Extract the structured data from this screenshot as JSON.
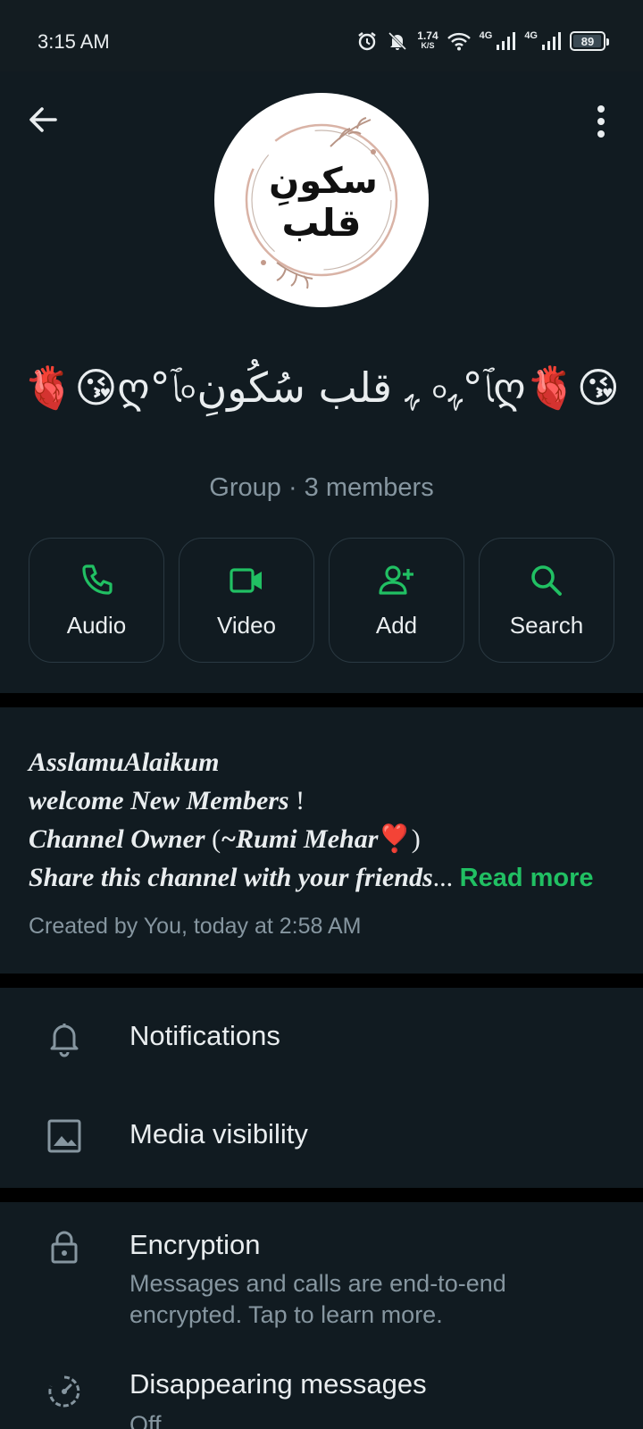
{
  "status_bar": {
    "time": "3:15 AM",
    "net_speed": "1.74",
    "net_unit": "K/S",
    "signal_1": "4G",
    "signal_2": "4G",
    "battery": "89",
    "icons": [
      "alarm-icon",
      "bell-muted-icon",
      "wifi-icon",
      "signal-icon",
      "signal-icon",
      "battery-icon"
    ]
  },
  "header": {
    "avatar_text_line1": "سکونِ",
    "avatar_text_line2": "قلب",
    "group_name": "🫀😘ღ°ﭑ৹ﮩ قلب سُکُونِ ৹ﭑ°ﮩღ🫀😘",
    "group_meta": "Group · 3 members"
  },
  "actions": [
    {
      "label": "Audio",
      "icon": "phone-icon"
    },
    {
      "label": "Video",
      "icon": "video-icon"
    },
    {
      "label": "Add",
      "icon": "add-person-icon"
    },
    {
      "label": "Search",
      "icon": "search-icon"
    }
  ],
  "description": {
    "line1": "AsslamuAlaikum",
    "line2_a": "welcome New Members",
    "line2_b": " !",
    "line3_a": "Channel Owner ",
    "line3_b": "(",
    "line3_c": "~Rumi Mehar",
    "line3_d": "❣️",
    "line3_e": ")",
    "line4": "Share this channel with your friends",
    "ellipsis": "...",
    "read_more": "Read more",
    "created": "Created by You, today at 2:58 AM"
  },
  "settings": {
    "notifications": "Notifications",
    "media_visibility": "Media visibility",
    "encryption": "Encryption",
    "encryption_sub": "Messages and calls are end-to-end encrypted. Tap to learn more.",
    "disappearing": "Disappearing messages",
    "disappearing_sub": "Off"
  },
  "colors": {
    "accent": "#21c063",
    "background": "#111b21",
    "secondary_text": "#8696a0"
  }
}
